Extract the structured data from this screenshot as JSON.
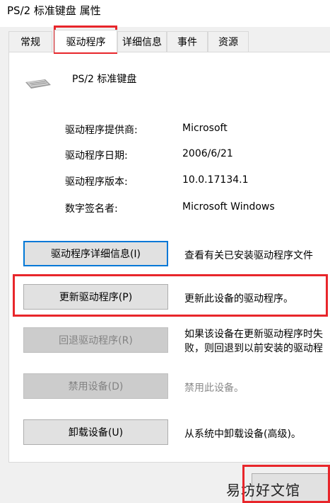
{
  "window": {
    "title": "PS/2 标准键盘 属性"
  },
  "tabs": [
    {
      "label": "常规"
    },
    {
      "label": "驱动程序"
    },
    {
      "label": "详细信息"
    },
    {
      "label": "事件"
    },
    {
      "label": "资源"
    }
  ],
  "device": {
    "name": "PS/2 标准键盘",
    "icon": "keyboard-icon"
  },
  "properties": [
    {
      "label": "驱动程序提供商:",
      "value": "Microsoft"
    },
    {
      "label": "驱动程序日期:",
      "value": "2006/6/21"
    },
    {
      "label": "驱动程序版本:",
      "value": "10.0.17134.1"
    },
    {
      "label": "数字签名者:",
      "value": "Microsoft Windows"
    }
  ],
  "actions": [
    {
      "button": "驱动程序详细信息(I)",
      "description": "查看有关已安装驱动程序文件"
    },
    {
      "button": "更新驱动程序(P)",
      "description": "更新此设备的驱动程序。"
    },
    {
      "button": "回退驱动程序(R)",
      "description": "如果该设备在更新驱动程序时失败，则回退到以前安装的驱动程序。"
    },
    {
      "button": "禁用设备(D)",
      "description": "禁用此设备。"
    },
    {
      "button": "卸载设备(U)",
      "description": "从系统中卸载设备(高级)。"
    }
  ],
  "watermark": "易坊好文馆",
  "colors": {
    "highlight": "#e8262b",
    "focus": "#0078d7"
  }
}
